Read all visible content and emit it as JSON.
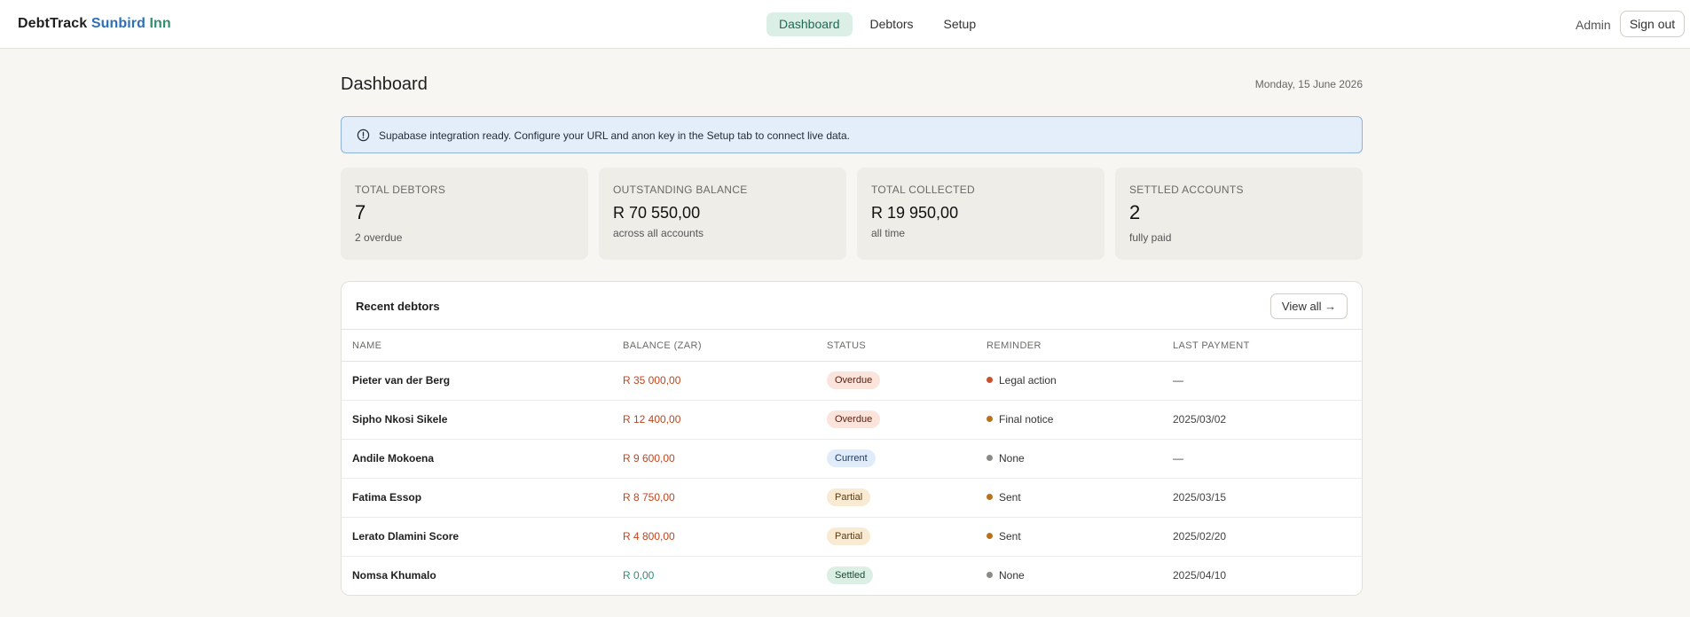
{
  "brand": {
    "part1": "DebtTrack",
    "part2": "Sunbird",
    "part3": "Inn"
  },
  "nav": {
    "tabs": [
      {
        "label": "Dashboard",
        "active": true
      },
      {
        "label": "Debtors"
      },
      {
        "label": "Setup"
      }
    ]
  },
  "user": {
    "name": "Admin",
    "signout_label": "Sign out"
  },
  "page": {
    "title": "Dashboard",
    "date": "Monday, 15 June 2026"
  },
  "banner": {
    "icon": "info-circle-icon",
    "text": "Supabase integration ready. Configure your URL and anon key in the Setup tab to connect live data."
  },
  "stats": [
    {
      "label": "TOTAL DEBTORS",
      "value": "7",
      "sub": "2 overdue"
    },
    {
      "label": "OUTSTANDING BALANCE",
      "value": "R 70 550,00",
      "sub": "across all accounts"
    },
    {
      "label": "TOTAL COLLECTED",
      "value": "R 19 950,00",
      "sub": "all time"
    },
    {
      "label": "SETTLED ACCOUNTS",
      "value": "2",
      "sub": "fully paid"
    }
  ],
  "recent": {
    "title": "Recent debtors",
    "view_all_label": "View all →",
    "columns": [
      "NAME",
      "BALANCE (ZAR)",
      "STATUS",
      "REMINDER",
      "LAST PAYMENT"
    ],
    "rows": [
      {
        "name": "Pieter van der Berg",
        "balance": "R 35 000,00",
        "status": "Overdue",
        "reminder": "Legal action",
        "reminder_color": "#c8502a",
        "last_payment": "—"
      },
      {
        "name": "Sipho Nkosi Sikele",
        "balance": "R 12 400,00",
        "status": "Overdue",
        "reminder": "Final notice",
        "reminder_color": "#b9721b",
        "last_payment": "2025/03/02"
      },
      {
        "name": "Andile Mokoena",
        "balance": "R 9 600,00",
        "status": "Current",
        "reminder": "None",
        "reminder_color": "#8a8a86",
        "last_payment": "—"
      },
      {
        "name": "Fatima Essop",
        "balance": "R 8 750,00",
        "status": "Partial",
        "reminder": "Sent",
        "reminder_color": "#b9721b",
        "last_payment": "2025/03/15"
      },
      {
        "name": "Lerato Dlamini Score",
        "balance": "R 4 800,00",
        "status": "Partial",
        "reminder": "Sent",
        "reminder_color": "#b9721b",
        "last_payment": "2025/02/20"
      },
      {
        "name": "Nomsa Khumalo",
        "balance": "R 0,00",
        "status": "Settled",
        "reminder": "None",
        "reminder_color": "#8a8a86",
        "last_payment": "2025/04/10"
      }
    ]
  },
  "colors": {
    "accent": "#1e6a54",
    "owed": "#c0451d",
    "paid": "#2f8f6f",
    "brand_blue": "#2e6fb8"
  }
}
